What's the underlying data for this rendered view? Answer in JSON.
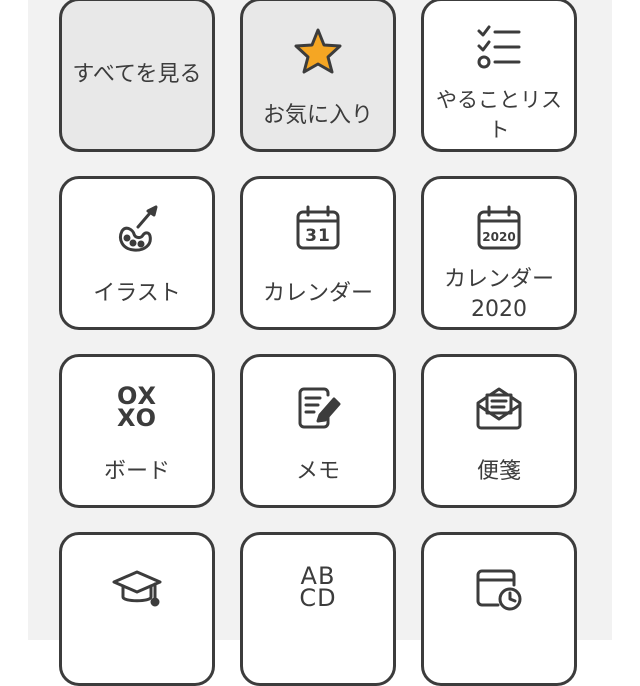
{
  "tiles": {
    "all": {
      "label": "すべてを見る"
    },
    "favorites": {
      "label": "お気に入り",
      "icon": "star-icon",
      "icon_color": "#f5a623"
    },
    "todo": {
      "label": "やることリスト",
      "icon": "checklist-icon"
    },
    "illust": {
      "label": "イラスト",
      "icon": "palette-brush-icon"
    },
    "calendar": {
      "label": "カレンダー",
      "icon": "calendar-icon",
      "icon_text": "31"
    },
    "calendar2020": {
      "label": "カレンダー",
      "label2": "2020",
      "icon": "calendar-icon",
      "icon_text": "2020"
    },
    "board": {
      "label": "ボード",
      "icon": "tic-tac-toe-icon",
      "icon_text_top": "OX",
      "icon_text_bottom": "XO"
    },
    "memo": {
      "label": "メモ",
      "icon": "memo-pencil-icon"
    },
    "stationery": {
      "label": "便箋",
      "icon": "open-envelope-icon"
    },
    "study": {
      "icon": "graduation-cap-icon"
    },
    "alphabet": {
      "icon": "alphabet-icon",
      "icon_text_top": "AB",
      "icon_text_bottom": "CD"
    },
    "schedule": {
      "icon": "calendar-clock-icon"
    }
  },
  "colors": {
    "panel_bg": "#f2f2f2",
    "tile_border": "#3c3c3c",
    "tile_selected_bg": "#e8e8e8",
    "accent_star": "#f5a623"
  }
}
